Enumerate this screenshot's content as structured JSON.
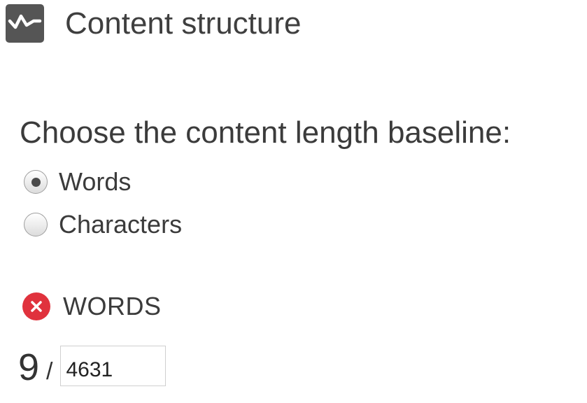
{
  "header": {
    "title": "Content structure",
    "icon": "pulse-chart-icon"
  },
  "baseline": {
    "prompt": "Choose the content length baseline:",
    "options": [
      {
        "label": "Words",
        "selected": true
      },
      {
        "label": "Characters",
        "selected": false
      }
    ]
  },
  "status": {
    "icon": "error-x-icon",
    "label": "WORDS"
  },
  "count": {
    "current": "9",
    "separator": "/",
    "target": "4631"
  },
  "colors": {
    "error": "#e0323d",
    "icon_bg": "#555555",
    "text": "#3b3b3b"
  }
}
